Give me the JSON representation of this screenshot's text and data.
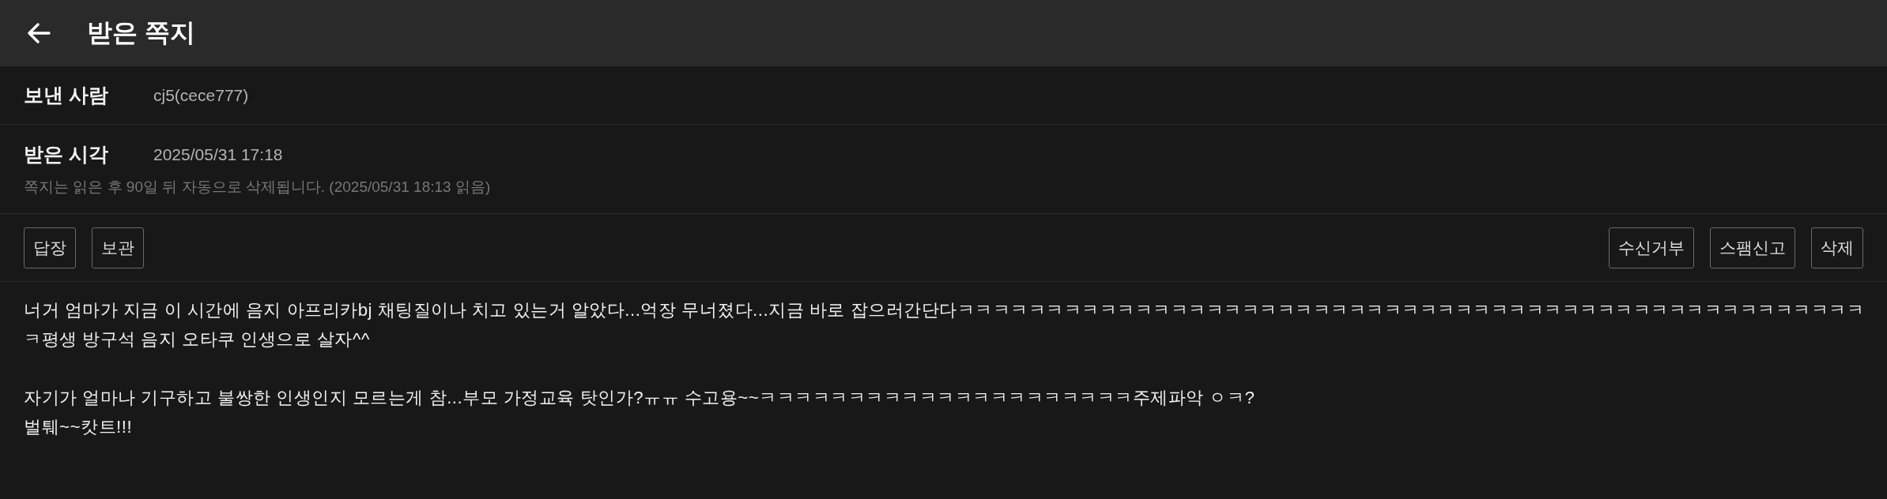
{
  "header": {
    "title": "받은 쪽지"
  },
  "details": [
    {
      "label": "보낸 사람",
      "value": "cj5(cece777)"
    },
    {
      "label": "받은 시각",
      "value": "2025/05/31 17:18",
      "note": "쪽지는 읽은 후 90일 뒤 자동으로 삭제됩니다. (2025/05/31 18:13 읽음)"
    }
  ],
  "actions": {
    "left": [
      "답장",
      "보관"
    ],
    "right": [
      "수신거부",
      "스팸신고",
      "삭제"
    ]
  },
  "message": {
    "paragraphs": [
      "너거 엄마가 지금 이 시간에 음지 아프리카bj 채팅질이나 치고 있는거 알았다...억장 무너졌다...지금 바로 잡으러간단다ㅋㅋㅋㅋㅋㅋㅋㅋㅋㅋㅋㅋㅋㅋㅋㅋㅋㅋㅋㅋㅋㅋㅋㅋㅋㅋㅋㅋㅋㅋㅋㅋㅋㅋㅋㅋㅋㅋㅋㅋㅋㅋㅋㅋㅋㅋㅋㅋㅋㅋㅋㅋ평생 방구석 음지 오타쿠 인생으로 살자^^",
      "자기가 얼마나 기구하고 불쌍한 인생인지 모르는게 참...부모 가정교육 탓인가?ㅠㅠ 수고용~~ㅋㅋㅋㅋㅋㅋㅋㅋㅋㅋㅋㅋㅋㅋㅋㅋㅋㅋㅋㅋㅋ주제파악 ㅇㅋ?\n벌퉤~~캇트!!!"
    ]
  }
}
